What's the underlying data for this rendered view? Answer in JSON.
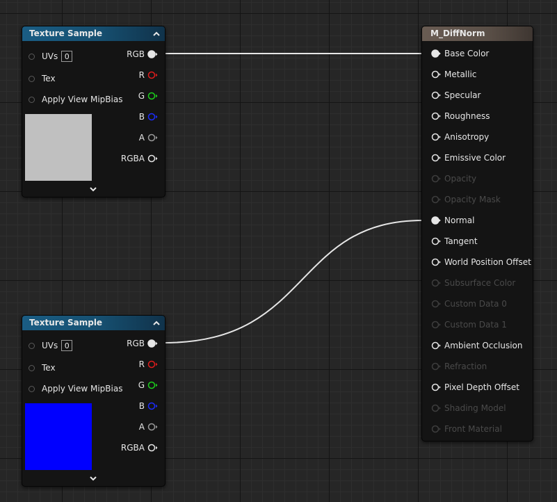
{
  "texture_nodes": [
    {
      "title": "Texture Sample",
      "inputs": {
        "uvs_label": "UVs",
        "uvs_value": "0",
        "tex_label": "Tex",
        "mipbias_label": "Apply View MipBias"
      },
      "outputs": [
        "RGB",
        "R",
        "G",
        "B",
        "A",
        "RGBA"
      ],
      "preview_color": "#c0c0c0",
      "rgb_connected": true
    },
    {
      "title": "Texture Sample",
      "inputs": {
        "uvs_label": "UVs",
        "uvs_value": "0",
        "tex_label": "Tex",
        "mipbias_label": "Apply View MipBias"
      },
      "outputs": [
        "RGB",
        "R",
        "G",
        "B",
        "A",
        "RGBA"
      ],
      "preview_color": "#0000ff",
      "rgb_connected": true
    }
  ],
  "material_node": {
    "title": "M_DiffNorm",
    "pins": [
      {
        "label": "Base Color",
        "enabled": true,
        "connected": true
      },
      {
        "label": "Metallic",
        "enabled": true,
        "connected": false
      },
      {
        "label": "Specular",
        "enabled": true,
        "connected": false
      },
      {
        "label": "Roughness",
        "enabled": true,
        "connected": false
      },
      {
        "label": "Anisotropy",
        "enabled": true,
        "connected": false
      },
      {
        "label": "Emissive Color",
        "enabled": true,
        "connected": false
      },
      {
        "label": "Opacity",
        "enabled": false,
        "connected": false
      },
      {
        "label": "Opacity Mask",
        "enabled": false,
        "connected": false
      },
      {
        "label": "Normal",
        "enabled": true,
        "connected": true
      },
      {
        "label": "Tangent",
        "enabled": true,
        "connected": false
      },
      {
        "label": "World Position Offset",
        "enabled": true,
        "connected": false
      },
      {
        "label": "Subsurface Color",
        "enabled": false,
        "connected": false
      },
      {
        "label": "Custom Data 0",
        "enabled": false,
        "connected": false
      },
      {
        "label": "Custom Data 1",
        "enabled": false,
        "connected": false
      },
      {
        "label": "Ambient Occlusion",
        "enabled": true,
        "connected": false
      },
      {
        "label": "Refraction",
        "enabled": false,
        "connected": false
      },
      {
        "label": "Pixel Depth Offset",
        "enabled": true,
        "connected": false
      },
      {
        "label": "Shading Model",
        "enabled": false,
        "connected": false
      },
      {
        "label": "Front Material",
        "enabled": false,
        "connected": false
      }
    ]
  },
  "connections": [
    {
      "from": "texture_nodes.0.RGB",
      "to": "material_node.Base Color"
    },
    {
      "from": "texture_nodes.1.RGB",
      "to": "material_node.Normal"
    }
  ],
  "colors": {
    "pin_white": "#e6e6e6",
    "pin_red": "#e01c1c",
    "pin_green": "#1cd01c",
    "pin_blue": "#1c2cff",
    "pin_gray": "#9a9a9a",
    "disabled_text": "#4a4a4a",
    "wire": "#e6e6e6"
  }
}
